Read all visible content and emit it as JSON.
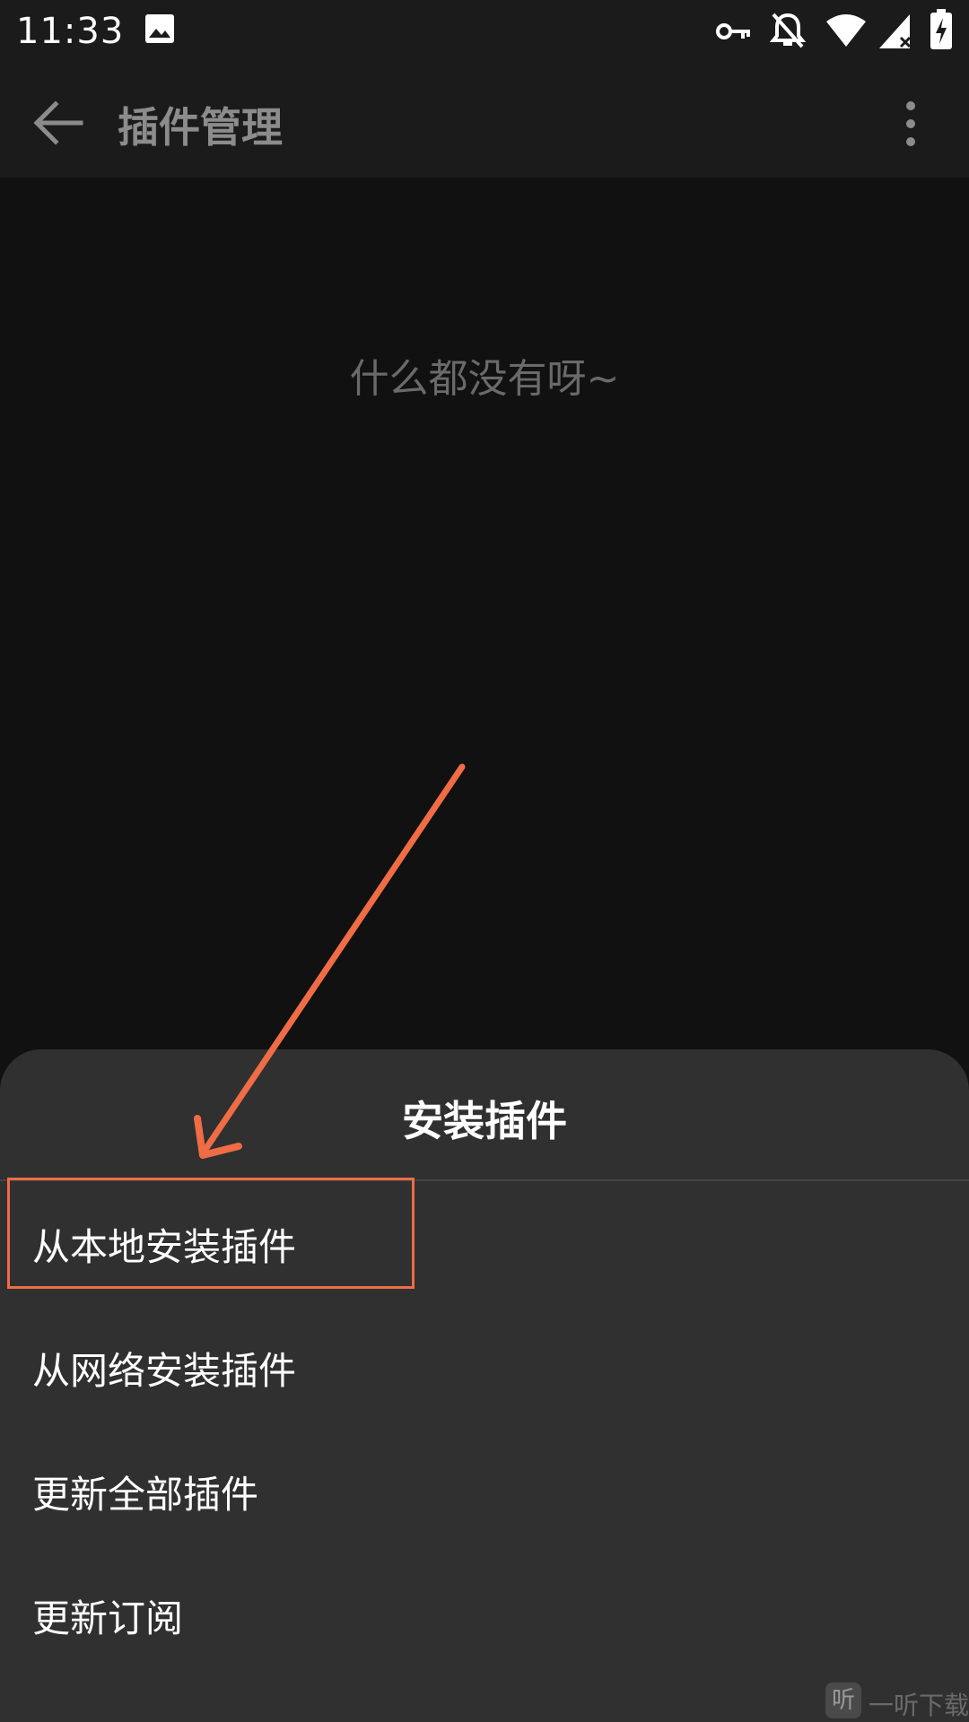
{
  "status_bar": {
    "time": "11:33",
    "icons": [
      "image-icon",
      "vpn-key-icon",
      "notifications-off-icon",
      "wifi-icon",
      "cellular-signal-icon",
      "battery-charging-icon"
    ]
  },
  "app_bar": {
    "title": "插件管理",
    "back_icon": "arrow-back-icon",
    "more_icon": "more-vert-icon"
  },
  "main": {
    "empty_message": "什么都没有呀~"
  },
  "bottom_sheet": {
    "title": "安装插件",
    "items": [
      {
        "label": "从本地安装插件"
      },
      {
        "label": "从网络安装插件"
      },
      {
        "label": "更新全部插件"
      },
      {
        "label": "更新订阅"
      }
    ]
  },
  "annotation": {
    "color": "#ef6c45"
  },
  "watermark": {
    "badge": "听",
    "text": "一听下载"
  }
}
